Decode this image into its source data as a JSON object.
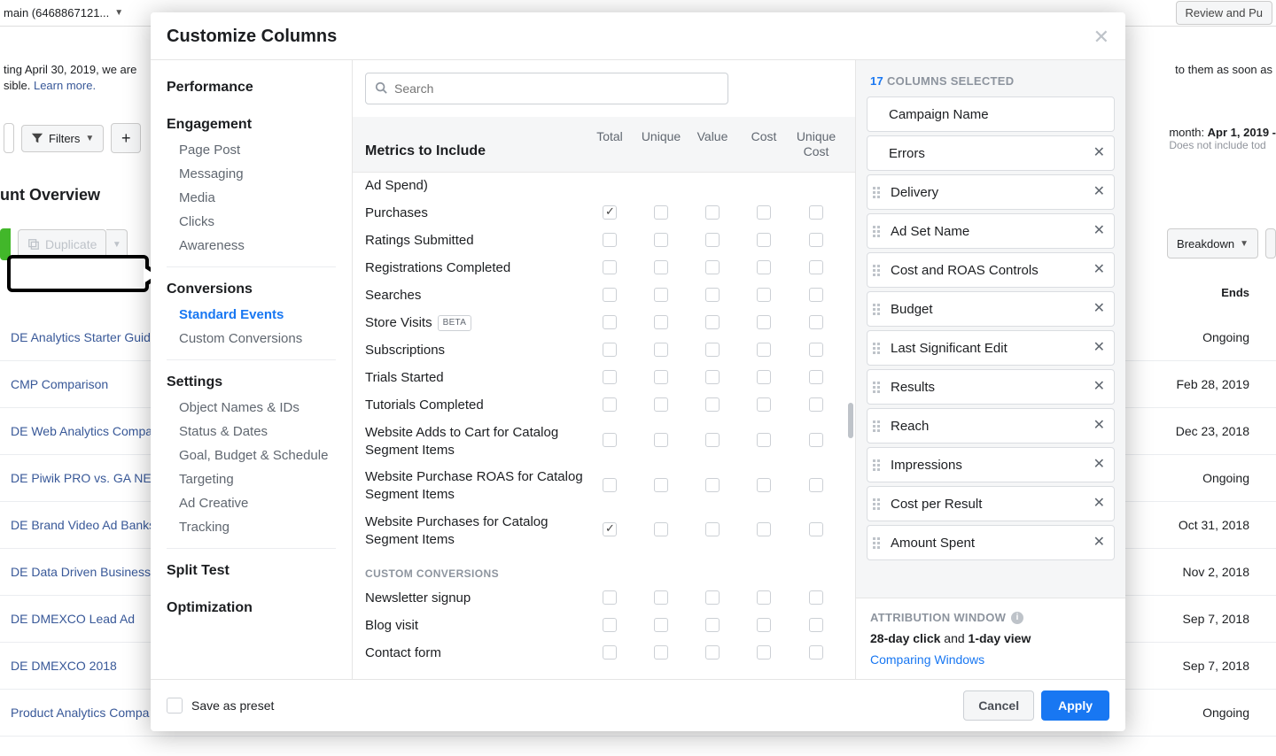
{
  "background": {
    "account_label": "main (6468867121...",
    "review_btn": "Review and Pu",
    "banner_line1": "ting April 30, 2019, we are ",
    "banner_line2_pre": "sible. ",
    "banner_link": "Learn more.",
    "banner_right": "to them as soon as",
    "filters_btn": "Filters",
    "date_line1_pre": "month: ",
    "date_line1_bold": "Apr 1, 2019 -",
    "date_line2": "Does not include tod",
    "overview": "unt Overview",
    "duplicate": "Duplicate",
    "breakdown": "Breakdown",
    "table_ends_header": "Ends",
    "rows": [
      {
        "name": "DE Analytics Starter Guid",
        "ends": "Ongoing"
      },
      {
        "name": "CMP Comparison",
        "ends": "Feb 28, 2019"
      },
      {
        "name": "DE Web Analytics Compa",
        "ends": "Dec 23, 2018"
      },
      {
        "name": "DE Piwik PRO vs. GA NEW",
        "ends": "Ongoing"
      },
      {
        "name": "DE Brand Video Ad Banks",
        "ends": "Oct 31, 2018"
      },
      {
        "name": "DE Data Driven Business",
        "ends": "Nov 2, 2018"
      },
      {
        "name": "DE DMEXCO Lead Ad",
        "ends": "Sep 7, 2018"
      },
      {
        "name": "DE DMEXCO 2018",
        "ends": "Sep 7, 2018"
      },
      {
        "name": "Product Analytics Compa",
        "ends": "Ongoing"
      }
    ]
  },
  "modal": {
    "title": "Customize Columns",
    "search_placeholder": "Search",
    "sidebar": {
      "groups": [
        {
          "title": "Performance",
          "items": []
        },
        {
          "title": "Engagement",
          "items": [
            "Page Post",
            "Messaging",
            "Media",
            "Clicks",
            "Awareness"
          ],
          "divider": true
        },
        {
          "title": "Conversions",
          "items": [
            "Standard Events",
            "Custom Conversions"
          ],
          "active_index": 0,
          "divider": true
        },
        {
          "title": "Settings",
          "items": [
            "Object Names & IDs",
            "Status & Dates",
            "Goal, Budget & Schedule",
            "Targeting",
            "Ad Creative",
            "Tracking"
          ],
          "divider": true
        },
        {
          "title": "Split Test",
          "items": []
        },
        {
          "title": "Optimization",
          "items": []
        }
      ]
    },
    "metrics": {
      "header_title": "Metrics to Include",
      "columns": [
        "Total",
        "Unique",
        "Value",
        "Cost",
        "Unique\nCost"
      ],
      "pre_row": "Ad Spend)",
      "rows": [
        {
          "label": "Purchases",
          "checks": [
            true,
            false,
            false,
            false,
            false
          ]
        },
        {
          "label": "Ratings Submitted",
          "checks": [
            false,
            false,
            false,
            false,
            false
          ]
        },
        {
          "label": "Registrations Completed",
          "checks": [
            false,
            false,
            false,
            false,
            false
          ]
        },
        {
          "label": "Searches",
          "checks": [
            false,
            false,
            false,
            false,
            false
          ]
        },
        {
          "label": "Store Visits",
          "beta": true,
          "checks": [
            false,
            false,
            false,
            false,
            false
          ]
        },
        {
          "label": "Subscriptions",
          "checks": [
            false,
            false,
            false,
            false,
            false
          ]
        },
        {
          "label": "Trials Started",
          "checks": [
            false,
            false,
            false,
            false,
            false
          ]
        },
        {
          "label": "Tutorials Completed",
          "checks": [
            false,
            false,
            false,
            false,
            false
          ]
        },
        {
          "label": "Website Adds to Cart for Catalog Segment Items",
          "checks": [
            false,
            false,
            false,
            false,
            false
          ]
        },
        {
          "label": "Website Purchase ROAS for Catalog Segment Items",
          "checks": [
            false,
            false,
            false,
            false,
            false
          ]
        },
        {
          "label": "Website Purchases for Catalog Segment Items",
          "checks": [
            true,
            false,
            false,
            false,
            false
          ]
        }
      ],
      "custom_section_label": "CUSTOM CONVERSIONS",
      "custom_rows": [
        {
          "label": "Newsletter signup",
          "checks": [
            false,
            false,
            false,
            false,
            false
          ]
        },
        {
          "label": "Blog visit",
          "checks": [
            false,
            false,
            false,
            false,
            false
          ]
        },
        {
          "label": "Contact form",
          "checks": [
            false,
            false,
            false,
            false,
            false
          ]
        }
      ],
      "beta_label": "BETA"
    },
    "selected": {
      "count": "17",
      "header_suffix": "COLUMNS SELECTED",
      "items": [
        {
          "name": "Campaign Name",
          "locked": true,
          "removable": false
        },
        {
          "name": "Errors",
          "locked": true,
          "removable": true
        },
        {
          "name": "Delivery",
          "locked": false,
          "removable": true
        },
        {
          "name": "Ad Set Name",
          "locked": false,
          "removable": true
        },
        {
          "name": "Cost and ROAS Controls",
          "locked": false,
          "removable": true
        },
        {
          "name": "Budget",
          "locked": false,
          "removable": true
        },
        {
          "name": "Last Significant Edit",
          "locked": false,
          "removable": true
        },
        {
          "name": "Results",
          "locked": false,
          "removable": true
        },
        {
          "name": "Reach",
          "locked": false,
          "removable": true
        },
        {
          "name": "Impressions",
          "locked": false,
          "removable": true
        },
        {
          "name": "Cost per Result",
          "locked": false,
          "removable": true
        },
        {
          "name": "Amount Spent",
          "locked": false,
          "removable": true
        }
      ]
    },
    "attribution": {
      "title": "ATTRIBUTION WINDOW",
      "bold1": "28-day click",
      "mid": " and ",
      "bold2": "1-day view",
      "link": "Comparing Windows"
    },
    "footer": {
      "save_preset": "Save as preset",
      "cancel": "Cancel",
      "apply": "Apply"
    }
  }
}
